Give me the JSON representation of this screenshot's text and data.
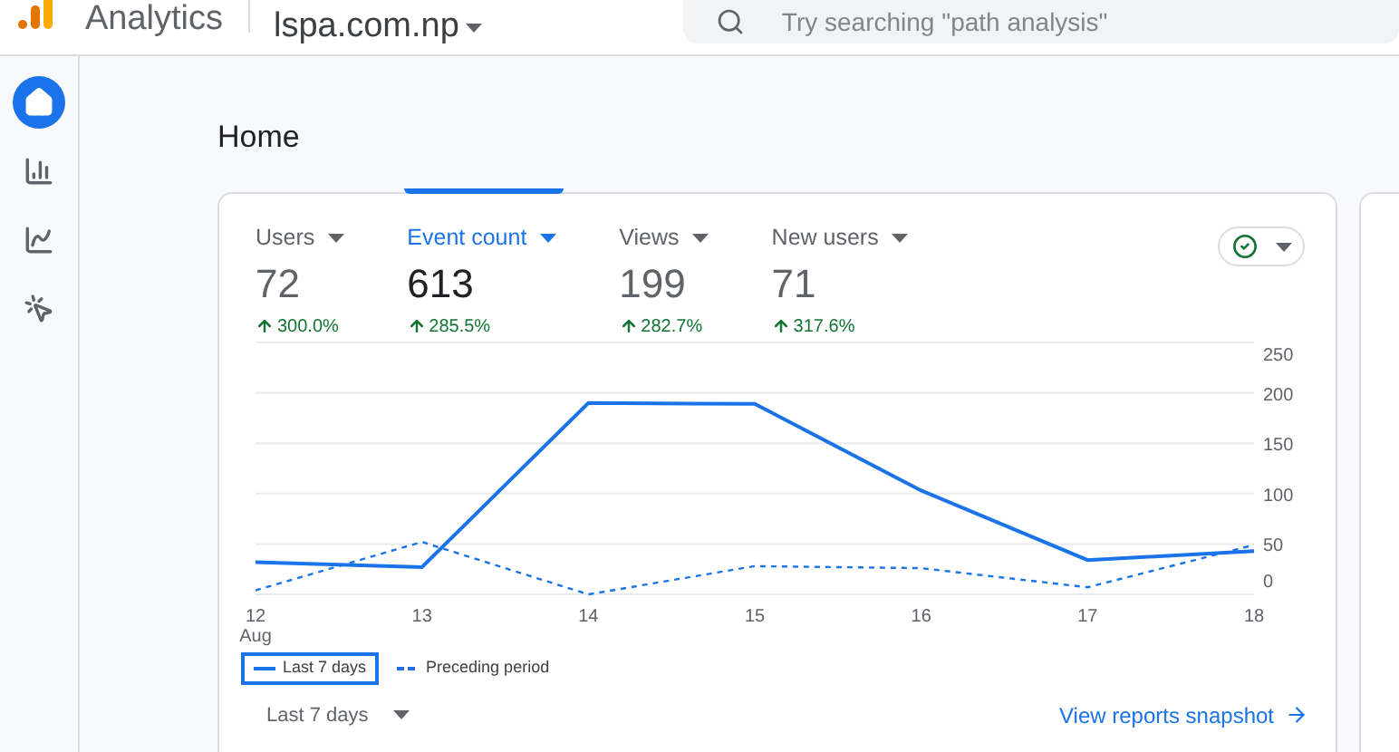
{
  "app": {
    "name": "Analytics",
    "property": "lspa.com.np"
  },
  "search": {
    "placeholder": "Try searching \"path analysis\""
  },
  "sidebar": {
    "items": [
      {
        "kind": "home",
        "selected": true
      },
      {
        "kind": "reports",
        "selected": false
      },
      {
        "kind": "explore",
        "selected": false
      },
      {
        "kind": "advertising",
        "selected": false
      }
    ]
  },
  "page": {
    "title": "Home"
  },
  "metrics": [
    {
      "label": "Users",
      "value": "72",
      "change": "300.0%",
      "selected": false
    },
    {
      "label": "Event count",
      "value": "613",
      "change": "285.5%",
      "selected": true
    },
    {
      "label": "Views",
      "value": "199",
      "change": "282.7%",
      "selected": false
    },
    {
      "label": "New users",
      "value": "71",
      "change": "317.6%",
      "selected": false
    }
  ],
  "chart_data": {
    "type": "line",
    "categories": [
      "12\nAug",
      "13",
      "14",
      "15",
      "16",
      "17",
      "18"
    ],
    "ylim": [
      0,
      250
    ],
    "yticks": [
      0,
      50,
      100,
      150,
      200,
      250
    ],
    "grid": true,
    "series": [
      {
        "name": "Last 7 days",
        "color": "#1a73e8",
        "line_style": "solid",
        "values": [
          32,
          27,
          190,
          189,
          103,
          34,
          43
        ]
      },
      {
        "name": "Preceding period",
        "color": "#1a73e8",
        "line_style": "dashed",
        "values": [
          4,
          52,
          0,
          28,
          26,
          7,
          49
        ]
      }
    ]
  },
  "legend": [
    {
      "selected": true
    },
    {
      "selected": false
    }
  ],
  "footer": {
    "range": "Last 7 days",
    "link": "View reports snapshot"
  }
}
